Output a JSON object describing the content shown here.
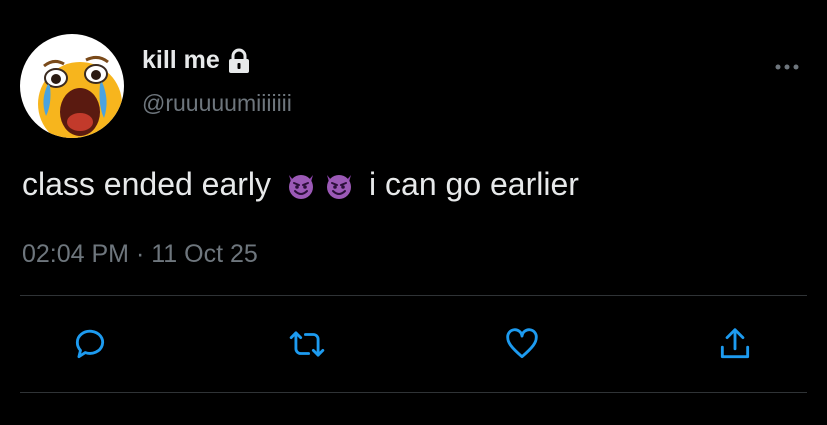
{
  "tweet": {
    "display_name": "kill me",
    "handle": "@ruuuuumiiiiiii",
    "text_before": "class ended early",
    "text_after": "i can go earlier",
    "emojis": [
      "smiling-imp-emoji",
      "smiling-imp-emoji"
    ],
    "timestamp": "02:04 PM · 11 Oct 25",
    "protected_account": true
  },
  "actions": [
    {
      "name": "reply",
      "icon": "reply-icon"
    },
    {
      "name": "retweet",
      "icon": "retweet-icon"
    },
    {
      "name": "like",
      "icon": "heart-icon"
    },
    {
      "name": "share",
      "icon": "share-icon"
    }
  ],
  "colors": {
    "background": "#000000",
    "primary_text": "#e7e9ea",
    "secondary_text": "#6e767d",
    "accent": "#1d9bf0",
    "divider": "#2f3336"
  }
}
